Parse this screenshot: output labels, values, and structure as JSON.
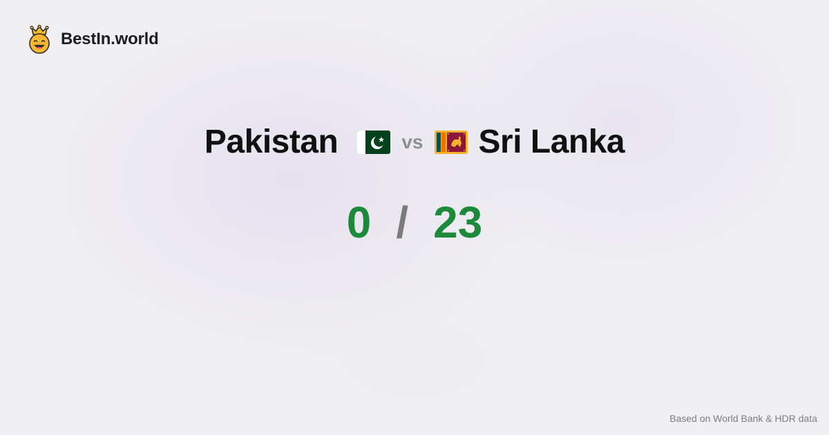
{
  "brand": {
    "name": "BestIn.world",
    "logo_icon": "crowned-smiley-icon"
  },
  "comparison": {
    "left_country": "Pakistan",
    "left_flag_icon": "pakistan-flag-icon",
    "vs_label": "vs",
    "right_country": "Sri Lanka",
    "right_flag_icon": "sri-lanka-flag-icon"
  },
  "score": {
    "left": "0",
    "separator": "/",
    "right": "23"
  },
  "footnote": "Based on World Bank & HDR data",
  "colors": {
    "score": "#1c8a3a",
    "separator": "#7b7b7b",
    "vs": "#8f8f93",
    "background": "#f0eff2"
  }
}
